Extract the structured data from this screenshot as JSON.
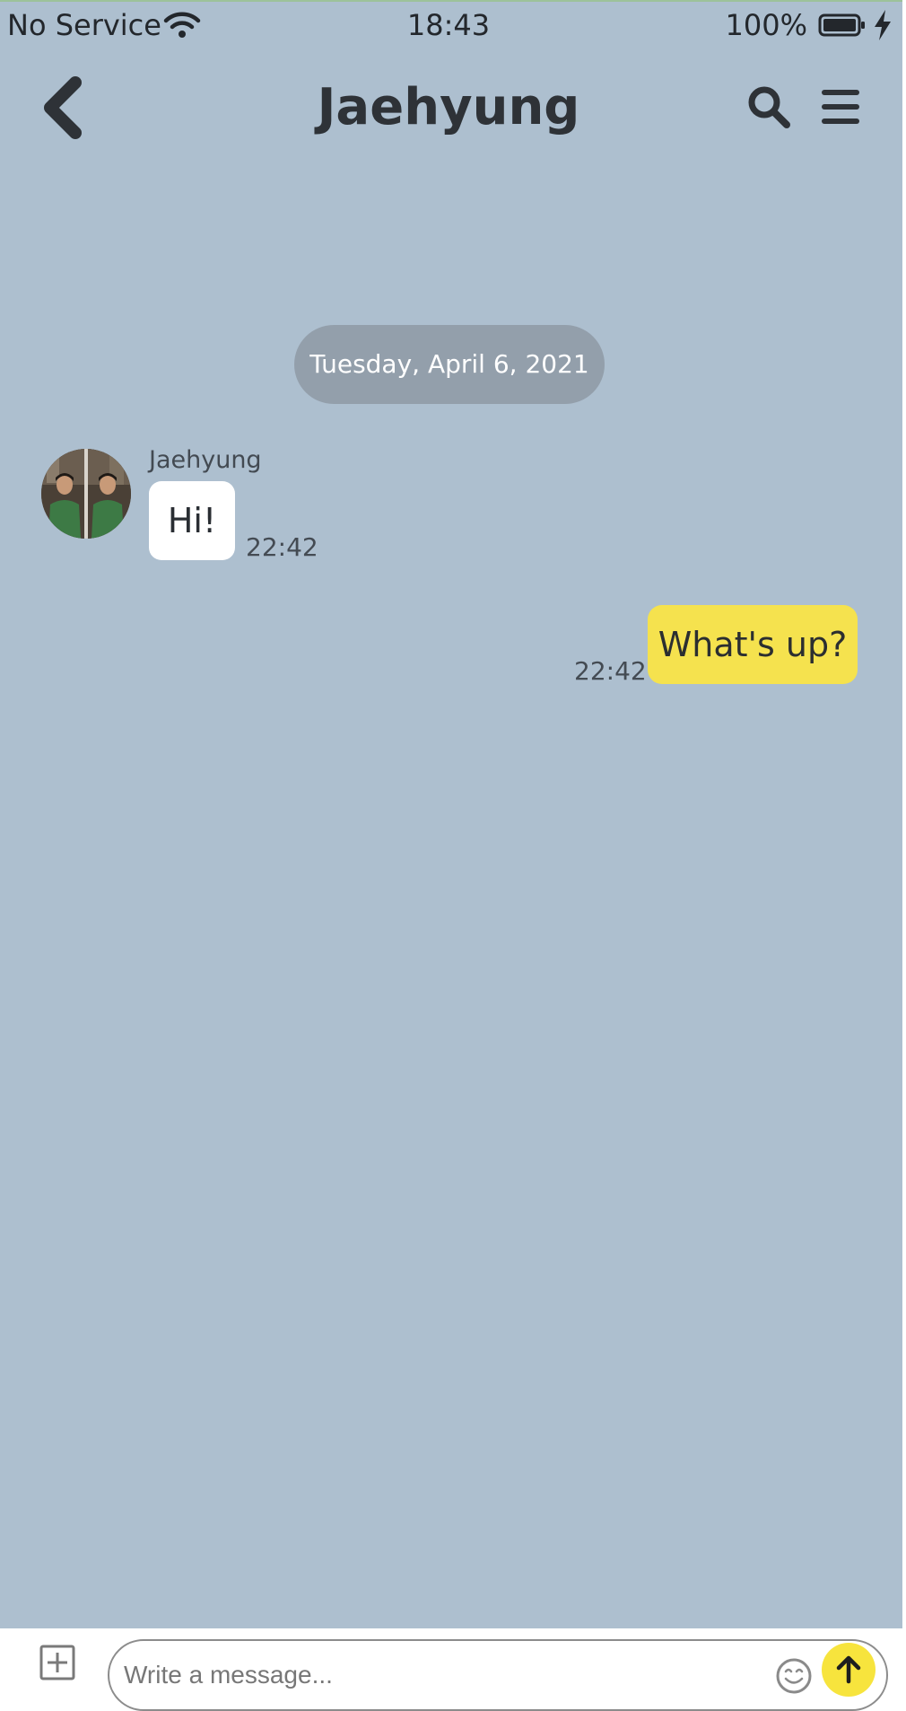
{
  "status_bar": {
    "carrier": "No Service",
    "time": "18:43",
    "battery_percent": "100%"
  },
  "header": {
    "title": "Jaehyung",
    "back_icon": "chevron-left-icon",
    "search_icon": "search-icon",
    "menu_icon": "hamburger-menu-icon"
  },
  "conversation": {
    "date_divider": "Tuesday, April 6, 2021",
    "messages": [
      {
        "direction": "incoming",
        "sender": "Jaehyung",
        "text": "Hi!",
        "time": "22:42"
      },
      {
        "direction": "outgoing",
        "text": "What's up?",
        "time": "22:42"
      }
    ]
  },
  "composer": {
    "placeholder": "Write a message...",
    "attach_icon": "plus-square-icon",
    "emoji_icon": "emoji-icon",
    "send_icon": "arrow-up-icon"
  },
  "colors": {
    "background": "#adbfcf",
    "date_pill": "#939fab",
    "incoming_bubble": "#ffffff",
    "outgoing_bubble": "#f5e24e",
    "send_button": "#f7e43d",
    "text_dark": "#2e3237"
  }
}
